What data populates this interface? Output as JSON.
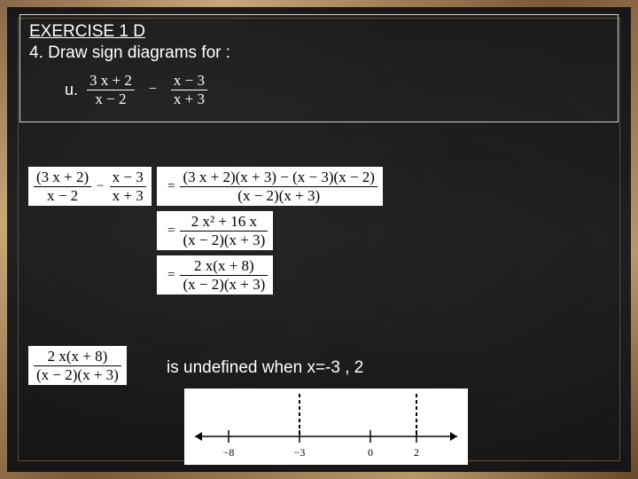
{
  "exercise": {
    "title": "EXERCISE 1 D",
    "prompt": "4. Draw sign diagrams for :",
    "item_label": "u.",
    "expr": {
      "f1_num": "3 x + 2",
      "f1_den": "x − 2",
      "minus": "−",
      "f2_num": "x − 3",
      "f2_den": "x + 3"
    }
  },
  "work": {
    "lhs": {
      "f1_num": "(3 x + 2)",
      "f1_den": "x − 2",
      "minus": "−",
      "f2_num": "x − 3",
      "f2_den": "x + 3",
      "eq": "="
    },
    "step1": {
      "eq": "=",
      "num": "(3 x + 2)(x + 3) − (x − 3)(x − 2)",
      "den": "(x − 2)(x + 3)"
    },
    "step2": {
      "eq": "=",
      "num": "2 x² + 16 x",
      "den": "(x − 2)(x + 3)"
    },
    "step3": {
      "eq": "=",
      "num": "2 x(x + 8)",
      "den": "(x − 2)(x + 3)"
    },
    "final": {
      "num": "2 x(x + 8)",
      "den": "(x − 2)(x + 3)"
    }
  },
  "undefined_text": "is undefined when x=-3 , 2",
  "number_line": {
    "ticks": [
      "−8",
      "−3",
      "0",
      "2"
    ],
    "dashed_at": [
      "−3",
      "2"
    ]
  }
}
